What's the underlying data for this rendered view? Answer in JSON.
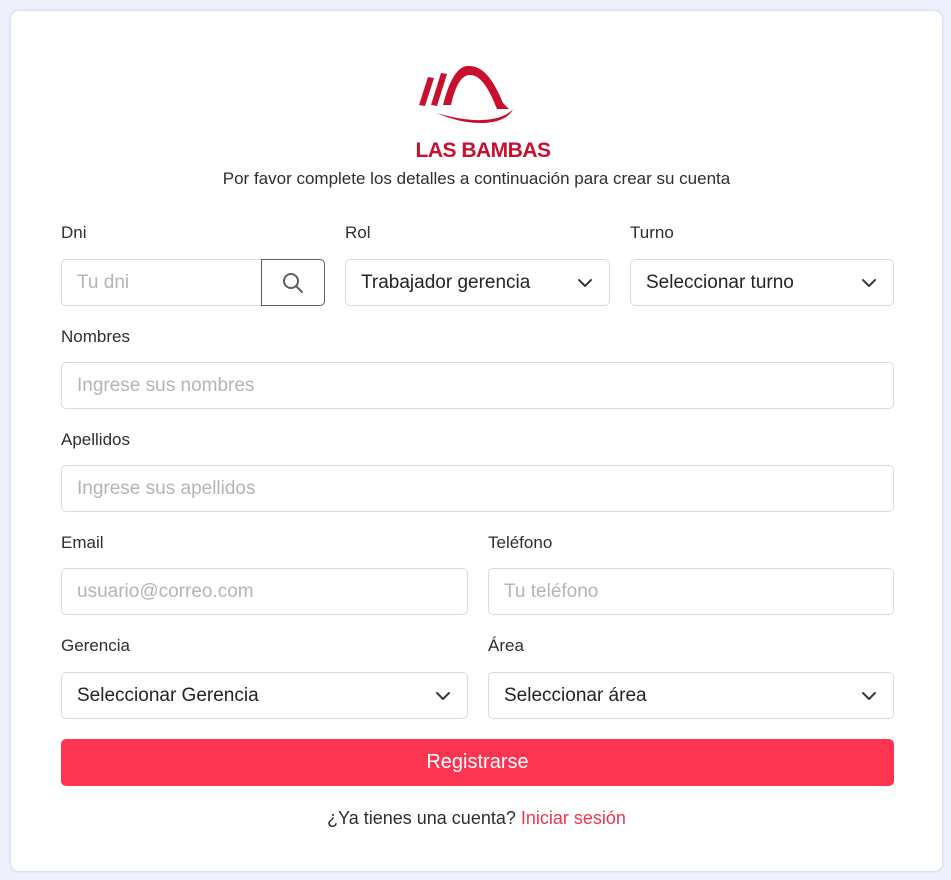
{
  "brand": {
    "name": "LAS BAMBAS",
    "color": "#c8102e"
  },
  "subtitle": "Por favor complete los detalles a continuación para crear su cuenta",
  "form": {
    "dni": {
      "label": "Dni",
      "placeholder": "Tu dni",
      "search_icon": "search-icon"
    },
    "rol": {
      "label": "Rol",
      "value": "Trabajador gerencia"
    },
    "turno": {
      "label": "Turno",
      "value": "Seleccionar turno"
    },
    "nombres": {
      "label": "Nombres",
      "placeholder": "Ingrese sus nombres"
    },
    "apellidos": {
      "label": "Apellidos",
      "placeholder": "Ingrese sus apellidos"
    },
    "email": {
      "label": "Email",
      "placeholder": "usuario@correo.com"
    },
    "telefono": {
      "label": "Teléfono",
      "placeholder": "Tu teléfono"
    },
    "gerencia": {
      "label": "Gerencia",
      "value": "Seleccionar Gerencia"
    },
    "area": {
      "label": "Área",
      "value": "Seleccionar área"
    },
    "submit_label": "Registrarse"
  },
  "footer": {
    "question": "¿Ya tienes una cuenta?",
    "link": "Iniciar sesión"
  },
  "colors": {
    "accent": "#fd3551",
    "background": "#eef0fb",
    "link": "#f0334f"
  }
}
